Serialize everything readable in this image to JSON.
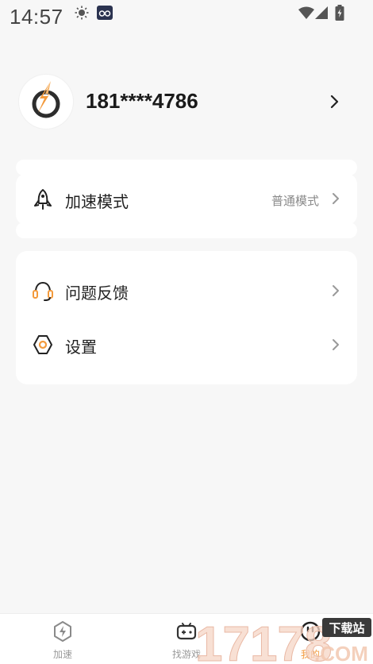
{
  "status_bar": {
    "time": "14:57"
  },
  "profile": {
    "phone": "181****4786"
  },
  "mode_card": {
    "label": "加速模式",
    "value": "普通模式"
  },
  "menu": {
    "items": [
      {
        "label": "问题反馈"
      },
      {
        "label": "设置"
      }
    ]
  },
  "tabbar": {
    "tabs": [
      {
        "label": "加速"
      },
      {
        "label": "找游戏"
      },
      {
        "label": "我的"
      }
    ]
  },
  "watermark": {
    "text": "17178",
    "sub": ".COM",
    "badge": "下载站"
  },
  "colors": {
    "accent": "#f39a3c",
    "text": "#222222",
    "muted": "#8a8a8a",
    "bg": "#f7f7f7"
  }
}
